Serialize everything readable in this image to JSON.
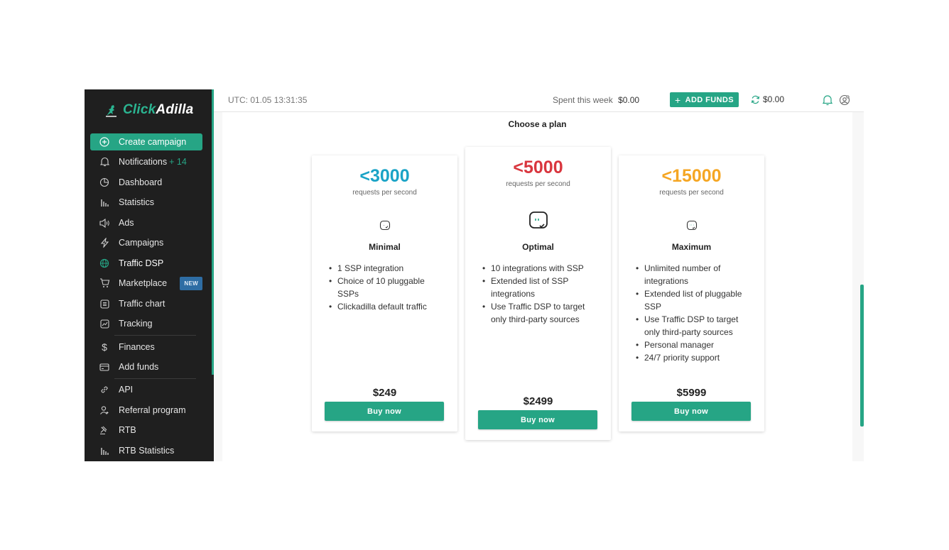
{
  "brand": {
    "name_part1": "Click",
    "name_part2": "Adilla",
    "accent": "#26a585"
  },
  "sidebar": {
    "items": [
      {
        "label": "Create campaign",
        "icon": "plus-circle-icon"
      },
      {
        "label": "Notifications",
        "count": "+ 14",
        "icon": "bell-icon"
      },
      {
        "label": "Dashboard",
        "icon": "pie-chart-icon"
      },
      {
        "label": "Statistics",
        "icon": "bar-chart-icon"
      },
      {
        "label": "Ads",
        "icon": "megaphone-icon"
      },
      {
        "label": "Campaigns",
        "icon": "lightning-icon"
      },
      {
        "label": "Traffic DSP",
        "icon": "globe-icon"
      },
      {
        "label": "Marketplace",
        "badge": "NEW",
        "icon": "cart-icon"
      },
      {
        "label": "Traffic chart",
        "icon": "list-icon"
      },
      {
        "label": "Tracking",
        "icon": "trend-icon"
      },
      {
        "label": "Finances",
        "icon": "dollar-icon"
      },
      {
        "label": "Add funds",
        "icon": "card-icon"
      },
      {
        "label": "API",
        "icon": "link-icon"
      },
      {
        "label": "Referral program",
        "icon": "user-plus-icon"
      },
      {
        "label": "RTB",
        "icon": "gavel-icon"
      },
      {
        "label": "RTB Statistics",
        "icon": "bar-chart-icon"
      }
    ]
  },
  "topbar": {
    "utc": "UTC: 01.05 13:31:35",
    "spent_label": "Spent this week",
    "spent_value": "$0.00",
    "add_funds_label": "ADD FUNDS",
    "balance": "$0.00"
  },
  "main": {
    "title": "Choose a plan",
    "plans": [
      {
        "rps": "<3000",
        "rps_color": "#1aa3c6",
        "rps_sub": "requests per second",
        "name": "Minimal",
        "features": [
          "1 SSP integration",
          "Choice of 10 pluggable SSPs",
          "Clickadilla default traffic"
        ],
        "price": "$249",
        "button": "Buy now"
      },
      {
        "rps": "<5000",
        "rps_color": "#d9363e",
        "rps_sub": "requests per second",
        "name": "Optimal",
        "features": [
          "10 integrations with SSP",
          "Extended list of SSP integrations",
          "Use Traffic DSP to target only third-party sources"
        ],
        "price": "$2499",
        "button": "Buy now"
      },
      {
        "rps": "<15000",
        "rps_color": "#f5a623",
        "rps_sub": "requests per second",
        "name": "Maximum",
        "features": [
          "Unlimited number of integrations",
          "Extended list of pluggable SSP",
          "Use Traffic DSP to target only third-party sources",
          "Personal manager",
          "24/7 priority support"
        ],
        "price": "$5999",
        "button": "Buy now"
      }
    ]
  }
}
